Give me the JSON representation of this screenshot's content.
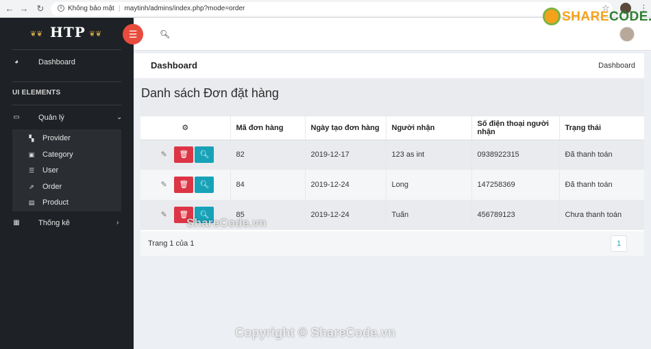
{
  "browser": {
    "security_label": "Không bảo mật",
    "url": "maytinh/admins/index.php?mode=order"
  },
  "watermark_brand": {
    "part1": "SHARE",
    "part2": "CODE.vn"
  },
  "sidebar": {
    "logo_text": "HTP",
    "dashboard_label": "Dashboard",
    "section_heading": "UI ELEMENTS",
    "manage_label": "Quản lý",
    "submenu": [
      {
        "label": "Provider",
        "icon": "sitemap-icon"
      },
      {
        "label": "Category",
        "icon": "book-icon"
      },
      {
        "label": "User",
        "icon": "list-icon"
      },
      {
        "label": "Order",
        "icon": "share-icon"
      },
      {
        "label": "Product",
        "icon": "id-card-icon"
      }
    ],
    "stats_label": "Thống kê"
  },
  "breadcrumb": {
    "title": "Dashboard",
    "current": "Dashboard"
  },
  "page": {
    "heading": "Danh sách Đơn đặt hàng"
  },
  "table": {
    "columns": [
      "",
      "Mã đơn hàng",
      "Ngày tạo đơn hàng",
      "Người nhận",
      "Số điện thoại người nhận",
      "Trạng thái"
    ],
    "rows": [
      {
        "id": "82",
        "date": "2019-12-17",
        "recipient": "123 as int",
        "phone": "0938922315",
        "status": "Đã thanh toán"
      },
      {
        "id": "84",
        "date": "2019-12-24",
        "recipient": "Long",
        "phone": "147258369",
        "status": "Đã thanh toán"
      },
      {
        "id": "85",
        "date": "2019-12-24",
        "recipient": "Tuấn",
        "phone": "456789123",
        "status": "Chưa thanh toán"
      }
    ]
  },
  "pagination": {
    "info": "Trang 1 của 1",
    "current_page": "1"
  },
  "watermarks": {
    "overlay": "ShareCode.vn",
    "footer": "Copyright © ShareCode.vn"
  },
  "colors": {
    "sidebar_bg": "#1e2125",
    "toggle_red": "#e74c3c",
    "delete_red": "#dc3545",
    "view_teal": "#17a2b8"
  }
}
